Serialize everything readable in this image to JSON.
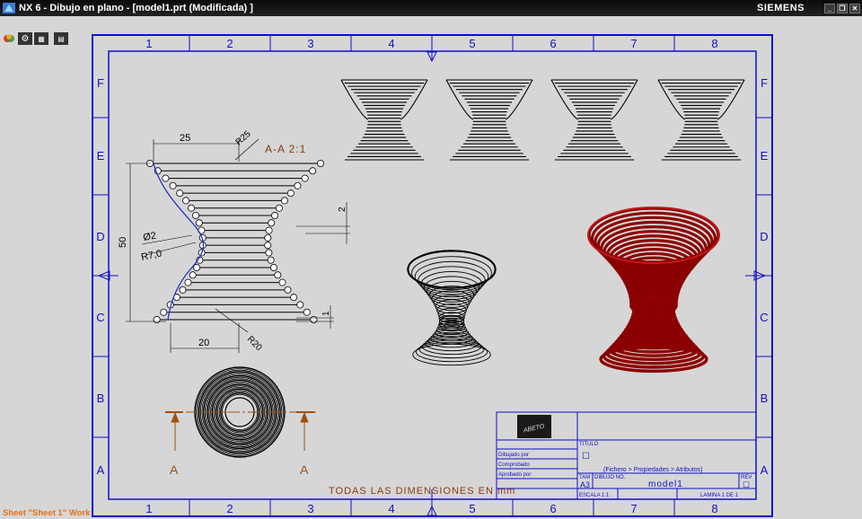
{
  "window": {
    "title": "NX 6 - Dibujo en plano - [model1.prt (Modificada) ]",
    "brand": "SIEMENS",
    "buttons": [
      "_",
      "❐",
      "✕"
    ]
  },
  "toolbar": {
    "icons": [
      "app-menu-icon",
      "settings-icon",
      "panel-icon",
      "layout-icon"
    ]
  },
  "status": {
    "text": "Sheet \"Sheet 1\" Work"
  },
  "border": {
    "columns": [
      "1",
      "2",
      "3",
      "4",
      "5",
      "6",
      "7",
      "8"
    ],
    "rows": [
      "F",
      "E",
      "D",
      "C",
      "B",
      "A"
    ]
  },
  "section_view": {
    "label": "A-A  2:1",
    "dim_width": "25",
    "dim_bottom": "20",
    "dim_height": "50",
    "dim_step": "2",
    "dim_step_bottom": "1",
    "r_top": "R25",
    "r_bottom": "R20",
    "diameter": "Ø2",
    "r_mid": "R7,0"
  },
  "section_marks": {
    "left": "A",
    "right": "A"
  },
  "note": "TODAS LAS DIMENSIONES EN mm",
  "title_block": {
    "logo_text": "ABETO",
    "drawn_by": "Dibujado por",
    "checked_by": "Comprobado",
    "approved_by": "Aprobado por",
    "title_label": "TITULO",
    "title_value": "☐",
    "size_label": "TAM",
    "size_value": "A3",
    "dwg_label": "DIBUJO NO.",
    "dwg_hint": "(Fichero > Propiedades > Atributos)",
    "dwg_value": "model1",
    "rev_label": "REV",
    "rev_value": "☐",
    "scale": "ESCALA 1:1",
    "sheet": "LAMINA 1 DE 1"
  },
  "colors": {
    "frame": "#1010c8",
    "geometry": "#000000",
    "dimension": "#7a3010",
    "shaded": "#a00000",
    "status": "#e8701a"
  }
}
